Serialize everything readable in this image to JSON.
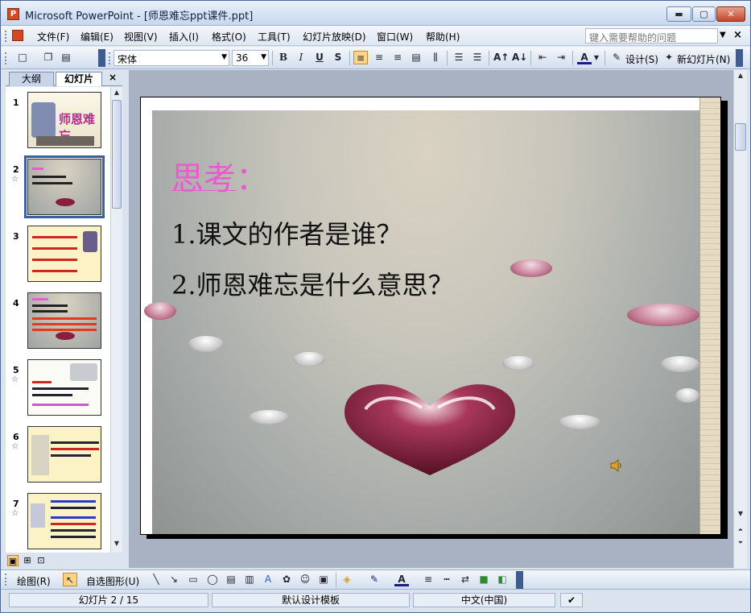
{
  "window": {
    "title": "Microsoft PowerPoint - [师恩难忘ppt课件.ppt]",
    "min_glyph": "▬",
    "max_glyph": "▢",
    "close_glyph": "✕"
  },
  "menu": {
    "items": [
      "文件(F)",
      "编辑(E)",
      "视图(V)",
      "插入(I)",
      "格式(O)",
      "工具(T)",
      "幻灯片放映(D)",
      "窗口(W)",
      "帮助(H)"
    ],
    "help_placeholder": "键入需要帮助的问题",
    "close_glyph": "×"
  },
  "toolbar": {
    "font_name": "宋体",
    "font_size": "36",
    "bold": "B",
    "italic": "I",
    "underline": "U",
    "shadow": "S",
    "design_label": "设计(S)",
    "new_slide_label": "新幻灯片(N)"
  },
  "left_pane": {
    "tabs": [
      "大纲",
      "幻灯片"
    ],
    "close_glyph": "×",
    "slides": [
      {
        "num": "1",
        "star": false,
        "thumb_title": "师恩难忘"
      },
      {
        "num": "2",
        "star": true,
        "thumb_title": ""
      },
      {
        "num": "3",
        "star": false,
        "thumb_title": ""
      },
      {
        "num": "4",
        "star": false,
        "thumb_title": ""
      },
      {
        "num": "5",
        "star": true,
        "thumb_title": ""
      },
      {
        "num": "6",
        "star": true,
        "thumb_title": ""
      },
      {
        "num": "7",
        "star": true,
        "thumb_title": ""
      }
    ],
    "selected_slide": "2"
  },
  "slide": {
    "title": "思考",
    "title_suffix": "：",
    "lines": [
      "1.课文的作者是谁？",
      "2.师恩难忘是什么意思？"
    ],
    "title_color": "#ea5ad0"
  },
  "drawbar": {
    "draw_label": "绘图(R)",
    "autoshapes_label": "自选图形(U)"
  },
  "status": {
    "slide_info": "幻灯片 2 / 15",
    "template": "默认设计模板",
    "language": "中文(中国)"
  }
}
